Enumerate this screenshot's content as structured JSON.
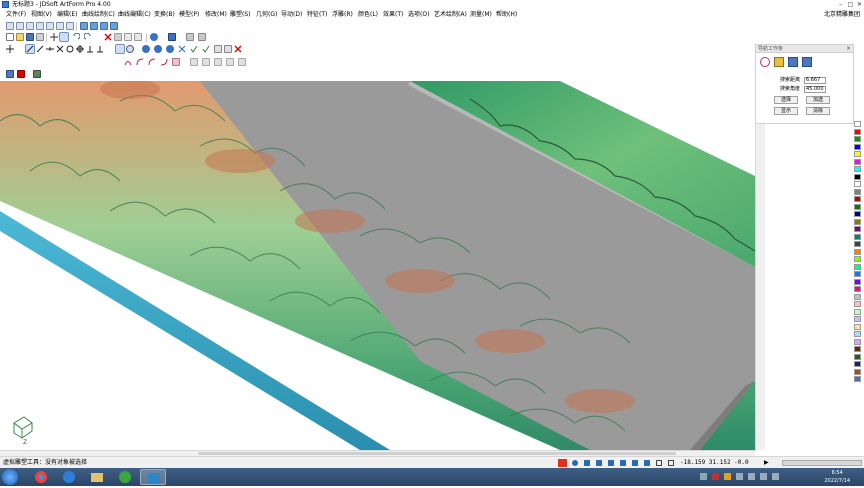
{
  "window": {
    "title": "无标题3 - JDSoft ArtForm Pro 4.00",
    "minimize_label": "–",
    "maximize_label": "□",
    "close_label": "✕"
  },
  "menu": {
    "items": [
      "文件(F)",
      "视图(V)",
      "编辑(E)",
      "曲线绘制(C)",
      "曲线编辑(C)",
      "变换(B)",
      "模型(P)",
      "修改(M)",
      "雕塑(S)",
      "几何(G)",
      "导动(D)",
      "特征(T)",
      "浮雕(R)",
      "颜色(L)",
      "效果(T)",
      "选项(O)",
      "艺术绘制(A)",
      "测量(M)",
      "帮助(H)"
    ],
    "company": "北京精雕集团"
  },
  "panel": {
    "title": "导航工作条",
    "close_label": "×",
    "distance_label": "搜索距离",
    "distance_value": "6.667",
    "angle_label": "搜索角度",
    "angle_value": "45.000",
    "buttons": [
      "选择",
      "加选",
      "显示",
      "清除"
    ]
  },
  "palette_colors": [
    "#ffffff",
    "#ff0000",
    "#00a000",
    "#0000ff",
    "#ffff00",
    "#ff00ff",
    "#00ffff",
    "#000000",
    "#ffffff",
    "#808080",
    "#c00000",
    "#008000",
    "#000080",
    "#808000",
    "#800080",
    "#008080",
    "#404040",
    "#ff8000",
    "#80ff00",
    "#00ff80",
    "#0080ff",
    "#8000ff",
    "#ff0080",
    "#c0c0c0",
    "#ffc0c0",
    "#c0ffc0",
    "#c0c0ff",
    "#ffe0a0",
    "#a0e0ff",
    "#e0a0ff",
    "#603000",
    "#206020",
    "#202060",
    "#a05020",
    "#5070a0"
  ],
  "statusbar": {
    "text": "虚拟雕塑工具：没有对象被选择",
    "coords": "-18.159 31.152 -0.0"
  },
  "clock": {
    "time": "6:54",
    "date": "2022/7/14"
  },
  "axis_label": "Z"
}
